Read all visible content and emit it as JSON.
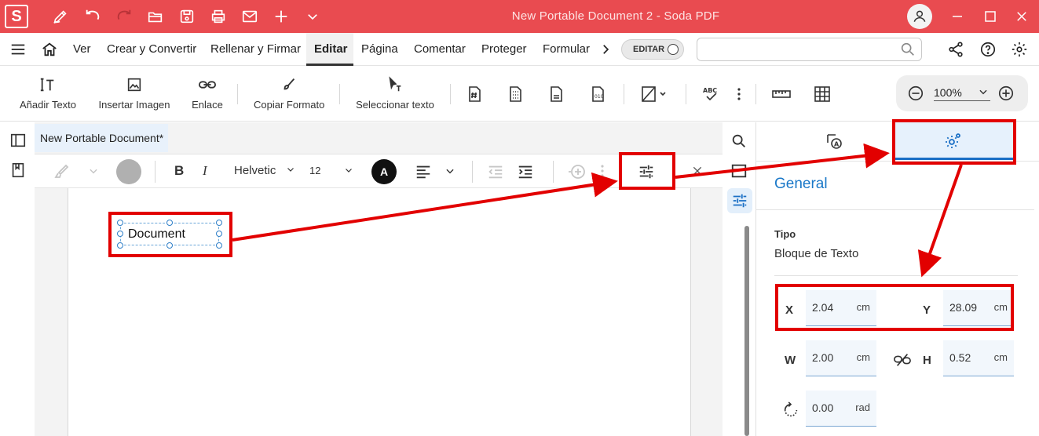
{
  "window": {
    "title": "New Portable Document 2   -   Soda PDF",
    "logo_letter": "S"
  },
  "colors": {
    "titlebar": "#e94b50",
    "accent": "#1a78c8",
    "annotation": "#e20000"
  },
  "menu": {
    "items": [
      "Ver",
      "Crear y Convertir",
      "Rellenar y Firmar",
      "Editar",
      "Página",
      "Comentar",
      "Proteger",
      "Formular"
    ],
    "active": "Editar",
    "edit_toggle_label": "EDITAR",
    "search_placeholder": ""
  },
  "ribbon": {
    "add_text": "Añadir Texto",
    "insert_image": "Insertar Imagen",
    "link": "Enlace",
    "copy_format": "Copiar Formato",
    "select_text": "Seleccionar texto",
    "zoom": "100%"
  },
  "document": {
    "tab_label": "New Portable Document*",
    "text_box_content": "Document"
  },
  "format_bar": {
    "font_name": "Helvetic",
    "font_size": "12",
    "font_color_letter": "A"
  },
  "properties": {
    "section_title": "General",
    "type_label": "Tipo",
    "type_value": "Bloque de Texto",
    "x": {
      "label": "X",
      "value": "2.04",
      "unit": "cm"
    },
    "y": {
      "label": "Y",
      "value": "28.09",
      "unit": "cm"
    },
    "w": {
      "label": "W",
      "value": "2.00",
      "unit": "cm"
    },
    "h": {
      "label": "H",
      "value": "0.52",
      "unit": "cm"
    },
    "rotation": {
      "value": "0.00",
      "unit": "rad"
    }
  }
}
